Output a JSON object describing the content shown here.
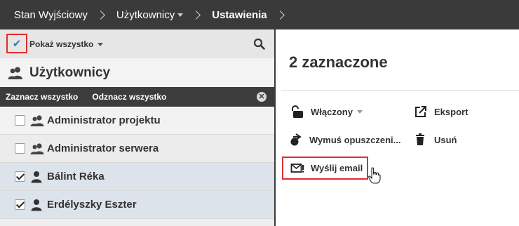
{
  "breadcrumb": {
    "items": [
      {
        "label": "Stan Wyjściowy"
      },
      {
        "label": "Użytkownicy"
      },
      {
        "label": "Ustawienia"
      }
    ]
  },
  "left_panel": {
    "filter": {
      "label": "Pokaż wszystko",
      "check_icon": "checkmark-icon",
      "search_icon": "search-icon"
    },
    "header": {
      "title": "Użytkownicy",
      "icon": "users-icon"
    },
    "select_bar": {
      "select_all": "Zaznacz wszystko",
      "deselect_all": "Odznacz wszystko",
      "close_icon": "close-icon"
    },
    "users": [
      {
        "name": "Administrator projektu",
        "checked": false,
        "icon": "group-icon"
      },
      {
        "name": "Administrator serwera",
        "checked": false,
        "icon": "group-icon"
      },
      {
        "name": "Bálint Réka",
        "checked": true,
        "icon": "user-icon"
      },
      {
        "name": "Erdélyszky Eszter",
        "checked": true,
        "icon": "user-icon"
      }
    ]
  },
  "right_panel": {
    "title": "2 zaznaczone",
    "actions": {
      "enabled": {
        "label": "Włączony",
        "icon": "unlock-icon"
      },
      "export": {
        "label": "Eksport",
        "icon": "export-icon"
      },
      "force_logout": {
        "label": "Wymuś opuszczeni...",
        "icon": "logout-icon"
      },
      "delete": {
        "label": "Usuń",
        "icon": "trash-icon"
      },
      "send_email": {
        "label": "Wyślij email",
        "icon": "email-icon"
      }
    }
  },
  "colors": {
    "topbar": "#3a3a3a",
    "highlight_border": "#e02d2d",
    "check_blue": "#2a7fb8",
    "selected_row": "#dde3ea"
  }
}
